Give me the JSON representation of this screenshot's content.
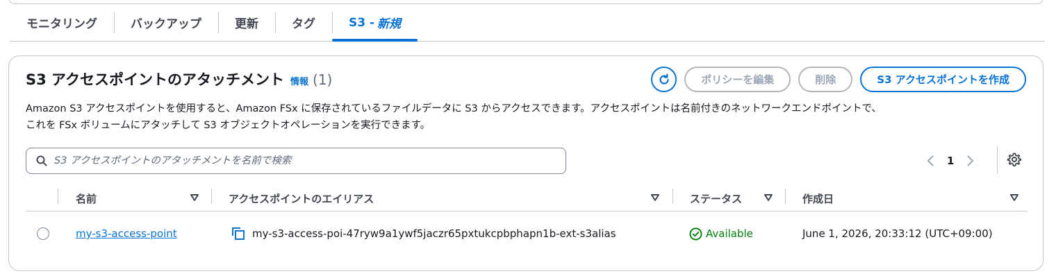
{
  "tabs": [
    {
      "label": "モニタリング"
    },
    {
      "label": "バックアップ"
    },
    {
      "label": "更新"
    },
    {
      "label": "タグ"
    },
    {
      "label": "S3 -",
      "badge": "新規"
    }
  ],
  "panel": {
    "title": "S3 アクセスポイントのアタッチメント",
    "info": "情報",
    "count": "(1)",
    "buttons": {
      "edit_policy": "ポリシーを編集",
      "delete": "削除",
      "create": "S3 アクセスポイントを作成"
    },
    "description_line1": "Amazon S3 アクセスポイントを使用すると、Amazon FSx に保存されているファイルデータに S3 からアクセスできます。アクセスポイントは名前付きのネットワークエンドポイントで、",
    "description_line2": "これを FSx ボリュームにアタッチして S3 オブジェクトオペレーションを実行できます。",
    "search_placeholder": "S3 アクセスポイントのアタッチメントを名前で検索",
    "page": "1"
  },
  "table": {
    "columns": [
      "名前",
      "アクセスポイントのエイリアス",
      "ステータス",
      "作成日"
    ],
    "rows": [
      {
        "name": "my-s3-access-point",
        "alias": "my-s3-access-poi-47ryw9a1ywf5jaczr65pxtukcpbphapn1b-ext-s3alias",
        "status": "Available",
        "created": "June 1, 2026, 20:33:12 (UTC+09:00)"
      }
    ]
  },
  "colors": {
    "accent": "#0972d3",
    "success": "#037f0c",
    "border": "#c6c6cd",
    "disabled": "#9ba7b6"
  },
  "icons": [
    "refresh-icon",
    "search-icon",
    "chevron-left-icon",
    "chevron-right-icon",
    "settings-gear-icon",
    "sort-caret-icon",
    "copy-icon",
    "status-check-icon"
  ]
}
